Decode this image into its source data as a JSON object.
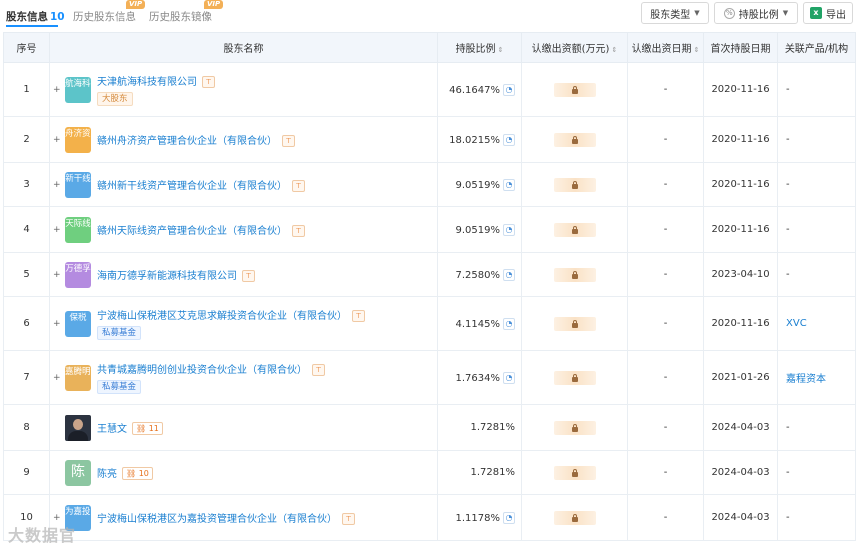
{
  "tabs": [
    {
      "label": "股东信息",
      "count": "10",
      "active": true
    },
    {
      "label": "历史股东信息",
      "vip": "VIP"
    },
    {
      "label": "历史股东镜像",
      "vip": "VIP"
    }
  ],
  "toolbar": {
    "filter_type_label": "股东类型",
    "filter_ratio_label": "持股比例",
    "export_label": "导出"
  },
  "table": {
    "headers": [
      "序号",
      "股东名称",
      "持股比例",
      "认缴出资额(万元)",
      "认缴出资日期",
      "首次持股日期",
      "关联产品/机构"
    ],
    "rows": [
      {
        "index": "1",
        "logo": "航海科技",
        "logo_color": "#5cc4c9",
        "name": "天津航海科技有限公司",
        "tag": "大股东",
        "tag_style": "orange",
        "ratio": "46.1647%",
        "date": "-",
        "first_date": "2020-11-16",
        "product": "-"
      },
      {
        "index": "2",
        "logo": "舟济资产",
        "logo_color": "#f3b14a",
        "name": "赣州舟济资产管理合伙企业（有限合伙）",
        "tag": "",
        "ratio": "18.0215%",
        "date": "-",
        "first_date": "2020-11-16",
        "product": "-"
      },
      {
        "index": "3",
        "logo": "新干线",
        "logo_color": "#5aa9e6",
        "name": "赣州新干线资产管理合伙企业（有限合伙）",
        "tag": "",
        "ratio": "9.0519%",
        "date": "-",
        "first_date": "2020-11-16",
        "product": "-"
      },
      {
        "index": "4",
        "logo": "天际线",
        "logo_color": "#6fcf7f",
        "name": "赣州天际线资产管理合伙企业（有限合伙）",
        "tag": "",
        "ratio": "9.0519%",
        "date": "-",
        "first_date": "2020-11-16",
        "product": "-"
      },
      {
        "index": "5",
        "logo": "万德孚",
        "logo_color": "#b48be0",
        "name": "海南万德孚新能源科技有限公司",
        "tag": "",
        "ratio": "7.2580%",
        "date": "-",
        "first_date": "2023-04-10",
        "product": "-"
      },
      {
        "index": "6",
        "logo": "保税",
        "logo_color": "#5aa9e6",
        "name": "宁波梅山保税港区艾克思求解投资合伙企业（有限合伙）",
        "tag": "私募基金",
        "tag_style": "blue",
        "ratio": "4.1145%",
        "date": "-",
        "first_date": "2020-11-16",
        "product": "XVC"
      },
      {
        "index": "7",
        "logo": "嘉腾明创",
        "logo_color": "#e9b25a",
        "name": "共青城嘉腾明创创业投资合伙企业（有限合伙）",
        "tag": "私募基金",
        "tag_style": "blue",
        "ratio": "1.7634%",
        "date": "-",
        "first_date": "2021-01-26",
        "product": "嘉程资本"
      },
      {
        "index": "8",
        "logo": "",
        "photo": true,
        "name": "王慧文",
        "person_count": "11",
        "tag": "",
        "ratio": "1.7281%",
        "date": "-",
        "first_date": "2024-04-03",
        "product": "-"
      },
      {
        "index": "9",
        "logo": "陈",
        "logo_color": "#8cc6a1",
        "name": "陈亮",
        "person_count": "10",
        "tag": "",
        "ratio": "1.7281%",
        "date": "-",
        "first_date": "2024-04-03",
        "product": "-"
      },
      {
        "index": "10",
        "logo": "为嘉投资",
        "logo_color": "#5aa9e6",
        "name": "宁波梅山保税港区为嘉投资管理合伙企业（有限合伙）",
        "tag": "",
        "ratio": "1.1178%",
        "date": "-",
        "first_date": "2024-04-03",
        "product": "-"
      }
    ]
  },
  "watermark": "大数据官"
}
